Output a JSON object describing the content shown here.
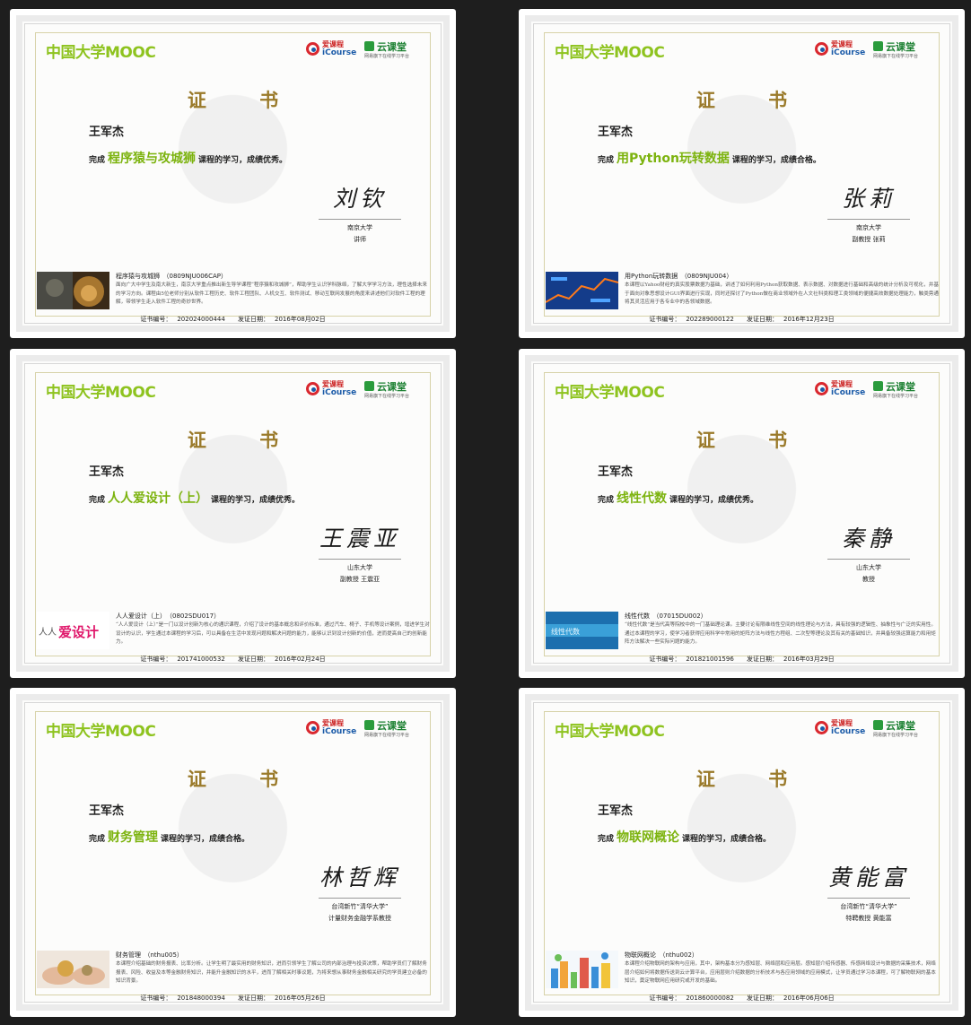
{
  "brand": "中国大学MOOC",
  "icourse": {
    "cn": "爱课程",
    "en": "iCourse"
  },
  "yunketang": {
    "name": "云课堂",
    "sub": "网易旗下在线学习平台"
  },
  "cert_title": "证 书",
  "student": "王军杰",
  "complete_prefix": "完成",
  "cert_no_label": "证书编号：",
  "issue_date_label": "发证日期：",
  "certificates": [
    {
      "course": "程序猿与攻城狮",
      "result": "课程的学习，成绩优秀。",
      "signature": "刘钦",
      "university": "南京大学",
      "role": "讲师",
      "code_line": "程序猿与攻城狮　（0809NJU006CAP）",
      "description": "面向广大中学生及南大新生，南京大学重点推出新生导学课程“程序猿和攻城狮”，帮助学生认识学科脉络，了解大学学习方法，理性选择未来的学习方向。课程由5位老师分别从软件工程历史、软件工程团队、人机交互、软件测试、移动互联网发展的角度来讲述他们对软件工程的理解，带领学生走入软件工程的奇妙世界。",
      "cert_no": "202024000444",
      "date": "2016年08月02日",
      "thumb": "lion"
    },
    {
      "course": "用Python玩转数据",
      "result": "课程的学习，成绩合格。",
      "signature": "张莉",
      "university": "南京大学",
      "role": "副教授 张莉",
      "code_line": "用Python玩转数据　（0809NJU004）",
      "description": "本课程以Yahoo财经的真实股票数据为基础，讲述了如何利用Python获取数据、表示数据、对数据进行基础和高级的统计分析及可视化，并基于面向对象思想设计GUI界面进行实现，同时还探讨了Python做在商业领域外在人文社科类和理工类领域的便捷高效数据处理能力，触类旁通将其灵活应用于各专业中的各领域数据。",
      "cert_no": "202289000122",
      "date": "2016年12月23日",
      "thumb": "stock"
    },
    {
      "course": "人人爱设计（上）",
      "result": "课程的学习，成绩优秀。",
      "signature": "王震亚",
      "university": "山东大学",
      "role": "副教授 王震亚",
      "code_line": "人人爱设计（上）　（0802SDU017）",
      "description": "“人人爱设计（上）”是一门以设计创新为核心的通识课程，介绍了设计的基本概念和评价标准，通过汽车、椅子、手机等设计案例，增进学生对设计的认识，学生通过本课程的学习后，可以具备在生活中发现问题和解决问题的能力，能够认识到设计创新的价值，进而提高自己的创新能力。",
      "cert_no": "201741000532",
      "date": "2016年02月24日",
      "thumb": "design"
    },
    {
      "course": "线性代数",
      "result": "课程的学习，成绩优秀。",
      "signature": "秦静",
      "university": "山东大学",
      "role": "教授",
      "code_line": "线性代数　（07015DU002）",
      "description": "“线性代数”是当代高等院校中的一门基础理论课。主要讨论有限维线性空间的线性理论与方法，具有较强的逻辑性、抽象性与广泛的实用性。通过本课程的学习，使学习者获得应用科学中常用的矩阵方法与线性方程组、二次型等理论及其有关的基础知识，并具备较强运算能力和用矩阵方法解决一些实际问题的能力。",
      "cert_no": "201821001596",
      "date": "2016年03月29日",
      "thumb": "linear"
    },
    {
      "course": "财务管理",
      "result": "课程的学习，成绩合格。",
      "signature": "林哲辉",
      "university": "台湾新竹“清华大学”",
      "role": "计量财务金融学系教授",
      "code_line": "财务管理　（nthu005）",
      "description": "本课程介绍基础的财务报表、比率分析。让学生明了最实用的财务知识，进而引领学生了解公司的内部治理与投资决策，帮助学员们了解财务报表、风险、收益及本等金融财务知识，并能升金融知识的水平，进而了解相关时事议题，为将来想从事财务金融相关研究的学员建立必备的知识背景。",
      "cert_no": "201848000394",
      "date": "2016年05月26日",
      "thumb": "finance"
    },
    {
      "course": "物联网概论",
      "result": "课程的学习，成绩合格。",
      "signature": "黄能富",
      "university": "台湾新竹“清华大学”",
      "role": "特聘教授 黄能富",
      "code_line": "物联网概论　（nthu002）",
      "description": "本课程介绍物联网的架构与应用，其中，架构基本分为感知层、网络层和应用层。感知层介绍传感器、传感网络设计与数据的采集技术，网络层介绍如何将数据传送到云计算平台，应用层则介绍数据的分析技术与各应用领域的应用模式，让学员通过学习本课程，可了解物联网的基本知识，奠定物联网应用研究或开发的基础。",
      "cert_no": "201860000082",
      "date": "2016年06月06日",
      "thumb": "iot"
    }
  ]
}
